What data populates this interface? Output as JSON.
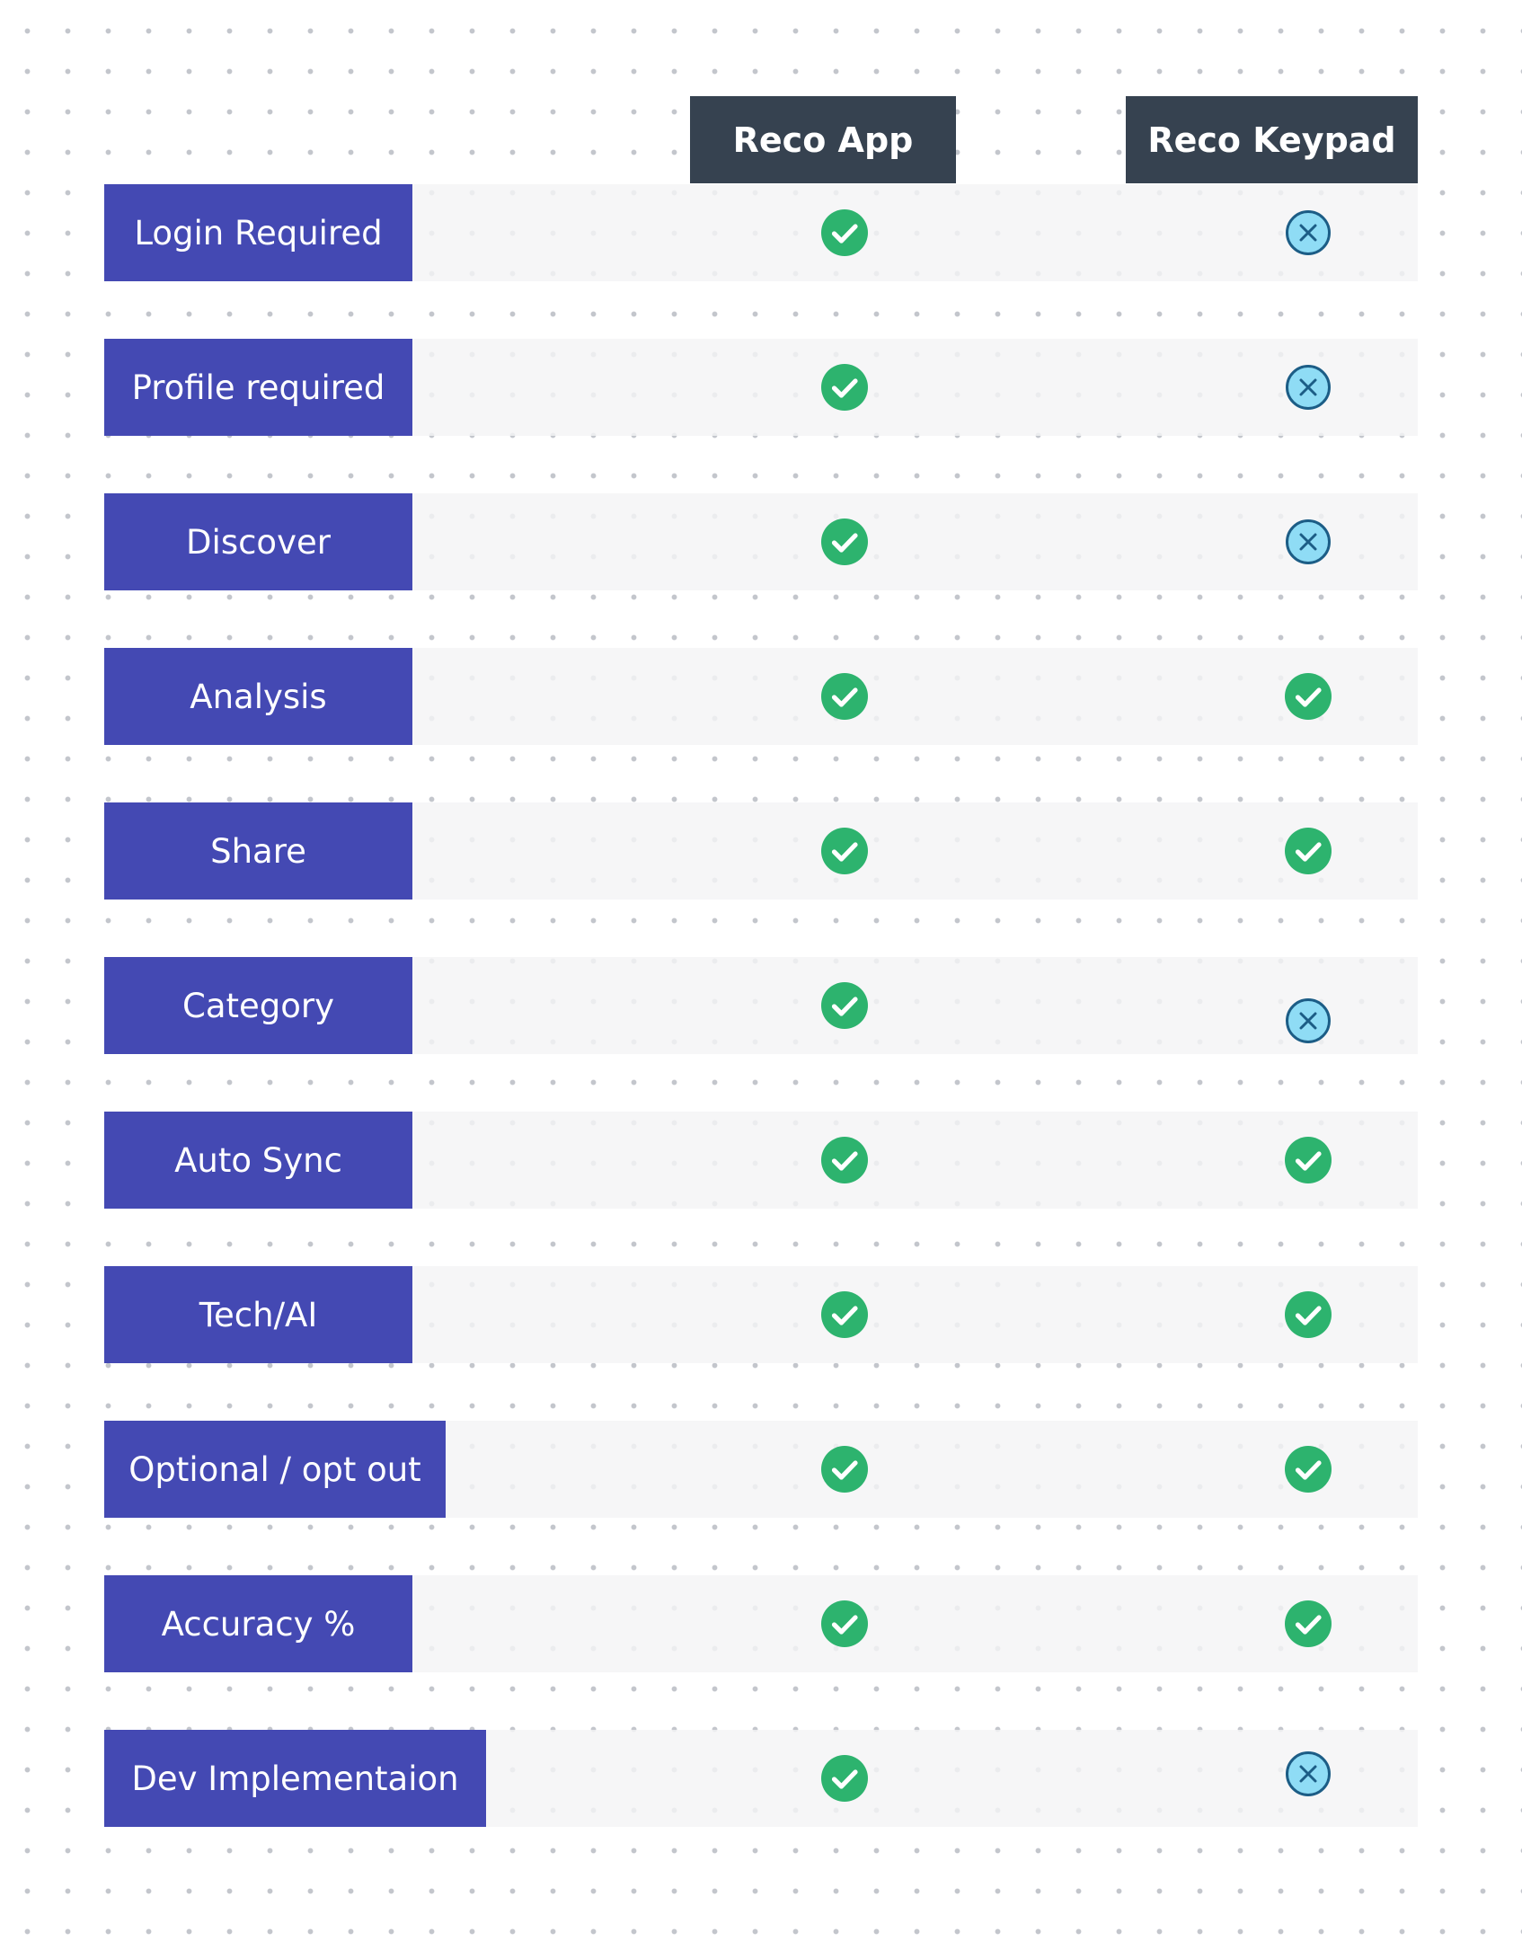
{
  "columns": [
    {
      "label": "Reco App"
    },
    {
      "label": "Reco Keypad"
    }
  ],
  "colors": {
    "header_bg": "#364250",
    "label_bg": "#4449b3",
    "check": "#2db36e",
    "cross_fill": "#8fdcf5",
    "cross_stroke": "#1c5d86"
  },
  "rows": [
    {
      "label": "Login Required",
      "reco_app": "check-icon",
      "reco_keypad": "cross-circle-icon"
    },
    {
      "label": "Profile required",
      "reco_app": "check-icon",
      "reco_keypad": "cross-circle-icon"
    },
    {
      "label": "Discover",
      "reco_app": "check-icon",
      "reco_keypad": "cross-circle-icon"
    },
    {
      "label": "Analysis",
      "reco_app": "check-icon",
      "reco_keypad": "check-icon"
    },
    {
      "label": "Share",
      "reco_app": "check-icon",
      "reco_keypad": "check-icon"
    },
    {
      "label": "Category",
      "reco_app": "check-icon",
      "reco_keypad": "cross-circle-icon"
    },
    {
      "label": "Auto Sync",
      "reco_app": "check-icon",
      "reco_keypad": "check-icon"
    },
    {
      "label": "Tech/AI",
      "reco_app": "check-icon",
      "reco_keypad": "check-icon"
    },
    {
      "label": "Optional / opt out",
      "reco_app": "check-icon",
      "reco_keypad": "check-icon"
    },
    {
      "label": "Accuracy %",
      "reco_app": "check-icon",
      "reco_keypad": "check-icon"
    },
    {
      "label": "Dev Implementaion",
      "reco_app": "check-icon",
      "reco_keypad": "cross-circle-icon"
    }
  ]
}
